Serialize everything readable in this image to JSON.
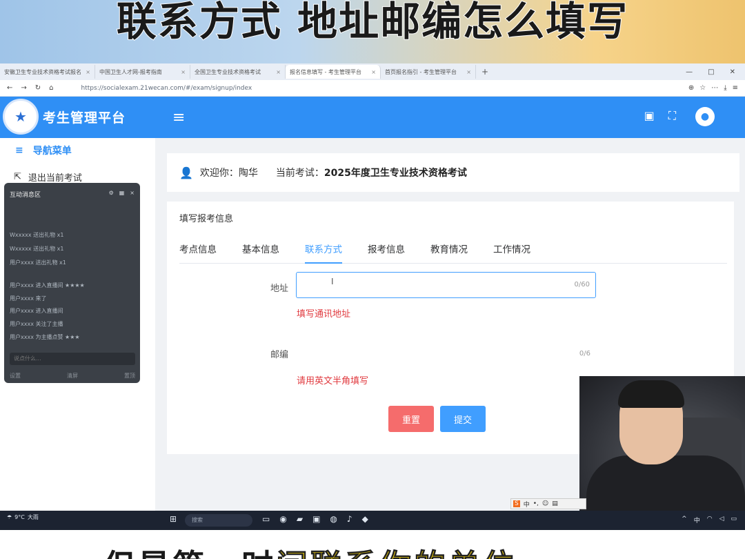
{
  "overlay": {
    "top_caption": "联系方式 地址邮编怎么填写",
    "bottom_caption_pre": "但是第一时",
    "bottom_caption_hl1": "间联系你的",
    "bottom_caption_hl2": "单位"
  },
  "browser": {
    "tabs": [
      {
        "label": "安徽卫生专业技术资格考试报名",
        "active": false
      },
      {
        "label": "中国卫生人才网-报考指南",
        "active": false
      },
      {
        "label": "全国卫生专业技术资格考试",
        "active": false
      },
      {
        "label": "报名信息填写 - 考生管理平台",
        "active": true
      },
      {
        "label": "首页报名指引 - 考生管理平台",
        "active": false
      }
    ],
    "new_tab": "+",
    "url": "https://socialexam.21wecan.com/#/exam/signup/index"
  },
  "app": {
    "title": "考生管理平台",
    "logo_glyph": "★",
    "menu_icon": "≡",
    "lock_icon": "🔒",
    "fullscreen_icon": "⛶",
    "avatar_icon": "●"
  },
  "sidebar": {
    "nav_title": "导航菜单",
    "exit_label": "退出当前考试"
  },
  "chat": {
    "title": "互动消息区",
    "rows": [
      "Wxxxxx 送出礼物 x1",
      "Wxxxxx 送出礼物 x1",
      "用户xxxx 送出礼物 x1",
      "用户xxxx 进入直播间 ★★★★",
      "用户xxxx 来了",
      "用户xxxx 进入直播间",
      "用户xxxx 关注了主播",
      "用户xxxx 为主播点赞 ★★★"
    ],
    "input_placeholder": "说点什么...",
    "footer": [
      "设置",
      "清屏",
      "置顶"
    ]
  },
  "welcome": {
    "greet_label": "欢迎你：",
    "user_name": "陶华",
    "exam_label": "当前考试：",
    "exam_name": "2025年度卫生专业技术资格考试"
  },
  "form": {
    "card_title": "填写报考信息",
    "tabs": [
      {
        "label": "考点信息",
        "active": false
      },
      {
        "label": "基本信息",
        "active": false
      },
      {
        "label": "联系方式",
        "active": true
      },
      {
        "label": "报考信息",
        "active": false
      },
      {
        "label": "教育情况",
        "active": false
      },
      {
        "label": "工作情况",
        "active": false
      }
    ],
    "address_label": "地址",
    "address_count": "0/60",
    "address_hint": "填写通讯地址",
    "zip_label": "邮编",
    "zip_count": "0/6",
    "zip_hint": "请用英文半角填写",
    "reset_label": "重置",
    "submit_label": "提交"
  },
  "taskbar": {
    "weather_temp": "9°C",
    "weather_desc": "大雨",
    "search_placeholder": "搜索",
    "ime_label": "中",
    "lang": "中"
  }
}
